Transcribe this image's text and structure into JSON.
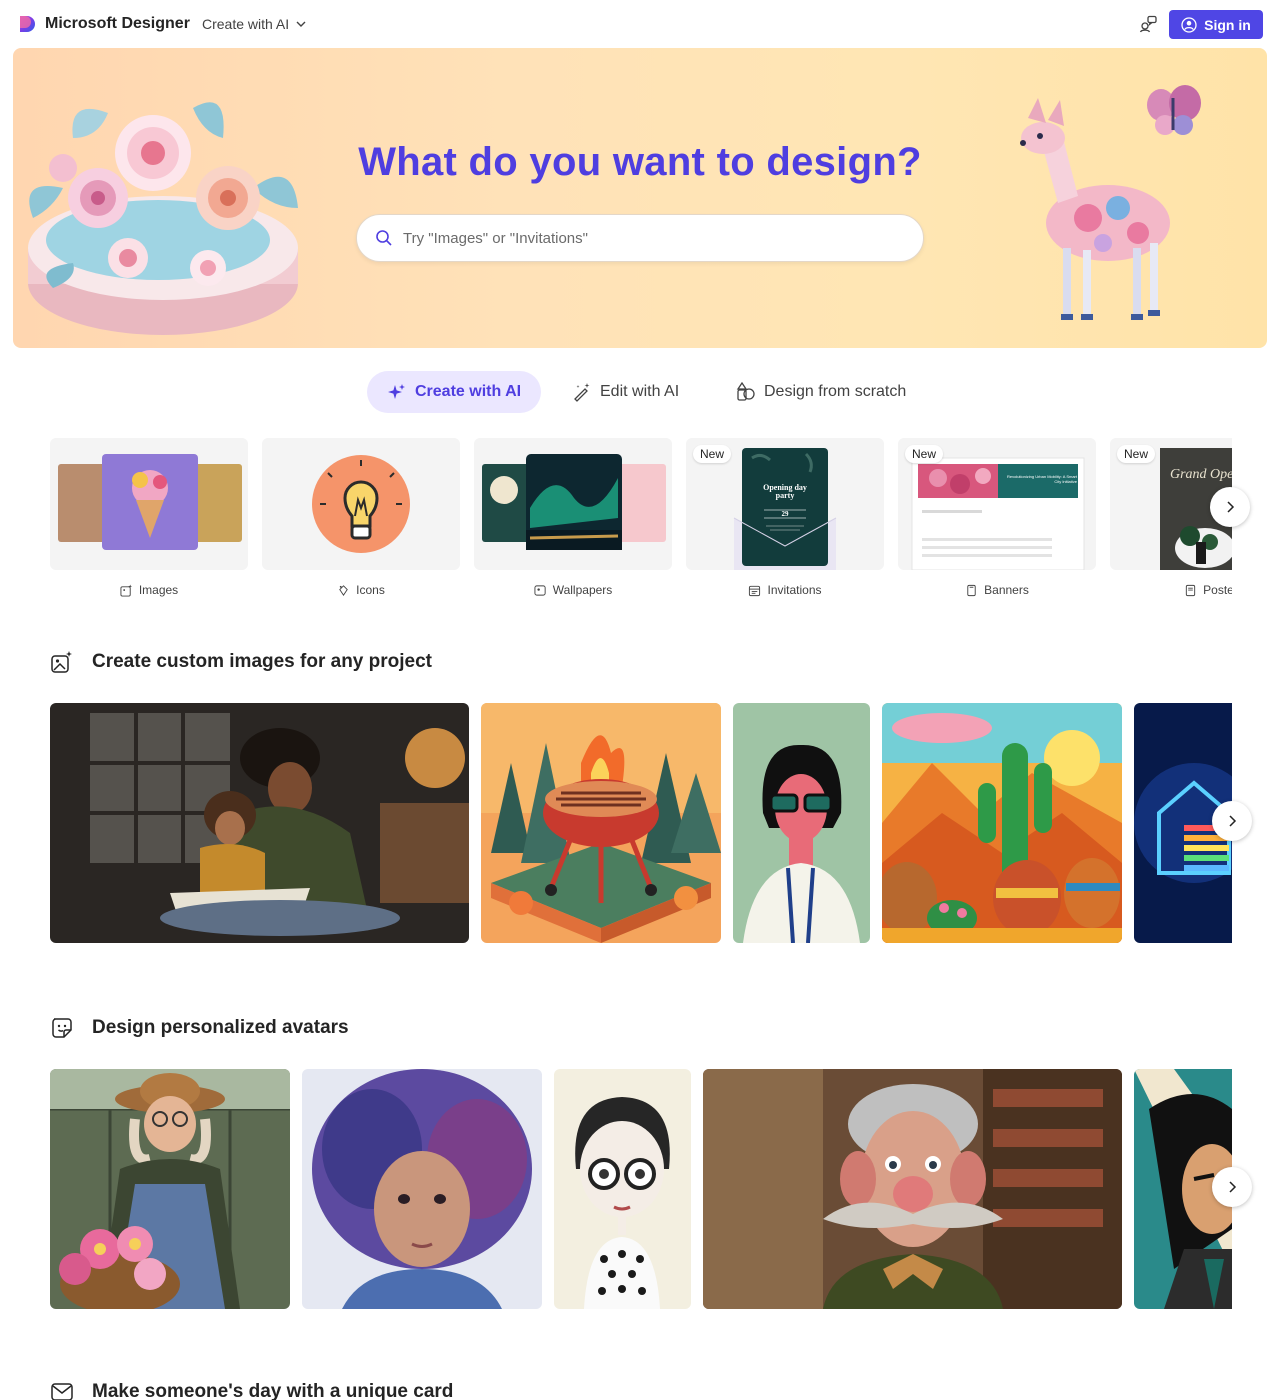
{
  "header": {
    "brand": "Microsoft Designer",
    "create_menu": "Create with AI",
    "sign_in": "Sign in"
  },
  "hero": {
    "title": "What do you want to design?",
    "search_placeholder": "Try \"Images\" or \"Invitations\""
  },
  "tabs": [
    {
      "label": "Create with AI",
      "active": true,
      "icon": "sparkle-icon"
    },
    {
      "label": "Edit with AI",
      "active": false,
      "icon": "magic-wand-icon"
    },
    {
      "label": "Design from scratch",
      "active": false,
      "icon": "shapes-icon"
    }
  ],
  "categories": [
    {
      "label": "Images",
      "icon": "image-sparkle-icon",
      "new": false
    },
    {
      "label": "Icons",
      "icon": "icon-sparkle-icon",
      "new": false
    },
    {
      "label": "Wallpapers",
      "icon": "wallpaper-icon",
      "new": false
    },
    {
      "label": "Invitations",
      "icon": "calendar-icon",
      "new": true,
      "badge": "New",
      "card_title": "Opening day party",
      "card_day": "29"
    },
    {
      "label": "Banners",
      "icon": "banner-icon",
      "new": true,
      "badge": "New",
      "card_title": "Revolutionizing Urban Mobility: A Smart City Initiative"
    },
    {
      "label": "Poste",
      "icon": "poster-icon",
      "new": true,
      "badge": "New",
      "card_title": "Grand Openi"
    }
  ],
  "sections": [
    {
      "title": "Create custom images for any project",
      "icon": "image-sparkle-icon"
    },
    {
      "title": "Design personalized avatars",
      "icon": "sticker-face-icon"
    },
    {
      "title": "Make someone's day with a unique card",
      "icon": "mail-icon"
    }
  ],
  "colors": {
    "accent": "#4f46e5",
    "hero_title": "#4f3ee0",
    "active_tab_bg": "#ebe7ff"
  }
}
